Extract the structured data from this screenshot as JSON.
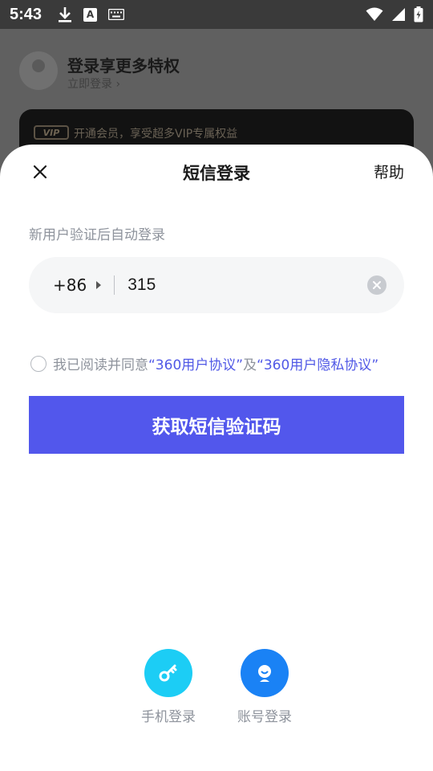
{
  "status_bar": {
    "time": "5:43",
    "keyboard_letter": "A"
  },
  "background": {
    "title": "登录享更多特权",
    "subtitle": "立即登录 ›",
    "vip_badge": "VIP",
    "vip_text": "开通会员，享受超多VIP专属权益"
  },
  "sheet": {
    "title": "短信登录",
    "help": "帮助",
    "hint": "新用户验证后自动登录",
    "country_code": "+86",
    "phone_value": "315",
    "agreement": {
      "prefix": "我已阅读并同意",
      "link1": "“360用户协议”",
      "conj": "及",
      "link2": "“360用户隐私协议”"
    },
    "submit": "获取短信验证码",
    "alt_logins": [
      {
        "label": "手机登录",
        "icon": "key-icon",
        "color": "#1ccdf5"
      },
      {
        "label": "账号登录",
        "icon": "user-icon",
        "color": "#1a82f5"
      }
    ]
  },
  "colors": {
    "accent": "#5257ec",
    "link": "#5058e6",
    "muted": "#8e939c"
  }
}
